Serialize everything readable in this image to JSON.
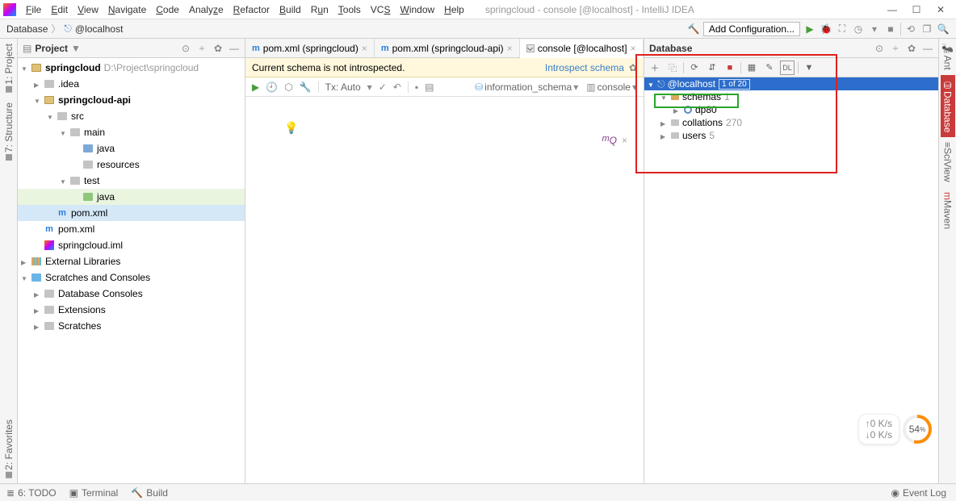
{
  "menu": {
    "items": [
      "File",
      "Edit",
      "View",
      "Navigate",
      "Code",
      "Analyze",
      "Refactor",
      "Build",
      "Run",
      "Tools",
      "VCS",
      "Window",
      "Help"
    ]
  },
  "window": {
    "title": "springcloud - console [@localhost] - IntelliJ IDEA"
  },
  "breadcrumb": {
    "root": "Database",
    "item": "@localhost"
  },
  "nav": {
    "add_config": "Add Configuration..."
  },
  "left_gutter": {
    "project": "1: Project",
    "structure": "7: Structure",
    "favorites": "2: Favorites"
  },
  "right_gutter": {
    "ant": "Ant",
    "database": "Database",
    "sciview": "SciView",
    "maven": "Maven"
  },
  "project_panel": {
    "title": "Project",
    "root": {
      "name": "springcloud",
      "path": "D:\\Project\\springcloud"
    },
    "nodes": {
      "idea": ".idea",
      "api": "springcloud-api",
      "src": "src",
      "main": "main",
      "java1": "java",
      "resources": "resources",
      "test": "test",
      "java2": "java",
      "pom_api": "pom.xml",
      "pom_root": "pom.xml",
      "iml": "springcloud.iml",
      "ext": "External Libraries",
      "scratches": "Scratches and Consoles",
      "db_consoles": "Database Consoles",
      "extensions": "Extensions",
      "scratches2": "Scratches"
    }
  },
  "tabs": {
    "t1": "pom.xml (springcloud)",
    "t2": "pom.xml (springcloud-api)",
    "t3": "console [@localhost]"
  },
  "schema_bar": {
    "msg": "Current schema is not introspected.",
    "link": "Introspect schema"
  },
  "editor_tools": {
    "tx": "Tx: Auto",
    "info_schema": "information_schema",
    "console": "console"
  },
  "db_panel": {
    "title": "Database",
    "root": "@localhost",
    "root_badge": "1 of 20",
    "schemas": {
      "label": "schemas",
      "count": "1"
    },
    "schema_item": "dp80",
    "collations": {
      "label": "collations",
      "count": "270"
    },
    "users": {
      "label": "users",
      "count": "5"
    }
  },
  "statusbar": {
    "todo": "6: TODO",
    "terminal": "Terminal",
    "build": "Build",
    "eventlog": "Event Log"
  },
  "meter": {
    "up": "↑0  K/s",
    "down": "↓0  K/s",
    "pct": "54"
  }
}
